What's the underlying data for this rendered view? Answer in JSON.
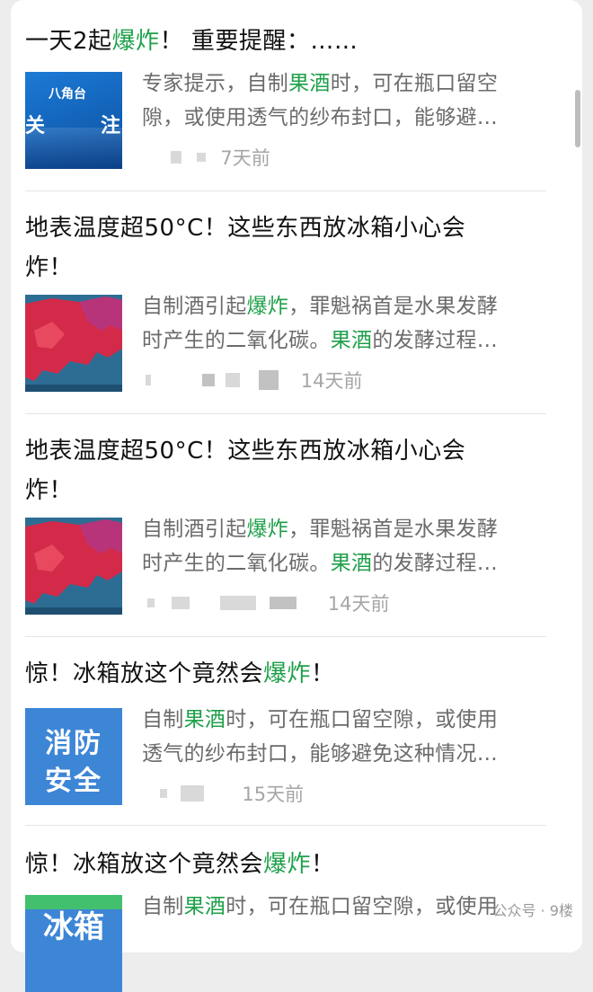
{
  "articles": [
    {
      "title_parts": [
        "一天2起",
        "爆炸",
        "！ 重要提醒：……"
      ],
      "line1_parts": [
        "专家提示，自制",
        "果酒",
        "时，可在瓶口留空"
      ],
      "line2_parts": [
        "隙，或使用透气的纱布封口，能够避…",
        "",
        ""
      ],
      "date": "7天前",
      "thumb_label": "八角台",
      "thumb_left": "关",
      "thumb_right": "注"
    },
    {
      "title_line1": "地表温度超50°C！这些东西放冰箱小心会",
      "title_line2": "炸！",
      "line1_parts": [
        "自制酒引起",
        "爆炸",
        "，罪魁祸首是水果发酵"
      ],
      "line2_parts": [
        "时产生的二氧化碳。",
        "果酒",
        "的发酵过程…"
      ],
      "date": "14天前"
    },
    {
      "title_line1": "地表温度超50°C！这些东西放冰箱小心会",
      "title_line2": "炸！",
      "line1_parts": [
        "自制酒引起",
        "爆炸",
        "，罪魁祸首是水果发酵"
      ],
      "line2_parts": [
        "时产生的二氧化碳。",
        "果酒",
        "的发酵过程…"
      ],
      "date": "14天前"
    },
    {
      "title_parts": [
        "惊！冰箱放这个竟然会",
        "爆炸",
        "！"
      ],
      "line1_parts": [
        "自制",
        "果酒",
        "时，可在瓶口留空隙，或使用"
      ],
      "line2_parts": [
        "透气的纱布封口，能够避免这种情况…",
        "",
        ""
      ],
      "date": "15天前",
      "thumb_line1": "消防",
      "thumb_line2": "安全"
    },
    {
      "title_parts": [
        "惊！冰箱放这个竟然会",
        "爆炸",
        "！"
      ],
      "line1_parts": [
        "自制",
        "果酒",
        "时，可在瓶口留空隙，或使用"
      ],
      "thumb_text": "冰箱"
    }
  ],
  "watermark": "公众号 · 9楼",
  "colors": {
    "keyword": "#1fa04a",
    "snippet": "#6b6b6b",
    "meta": "#a6a6a6",
    "fire_blue": "#3d86d6"
  }
}
